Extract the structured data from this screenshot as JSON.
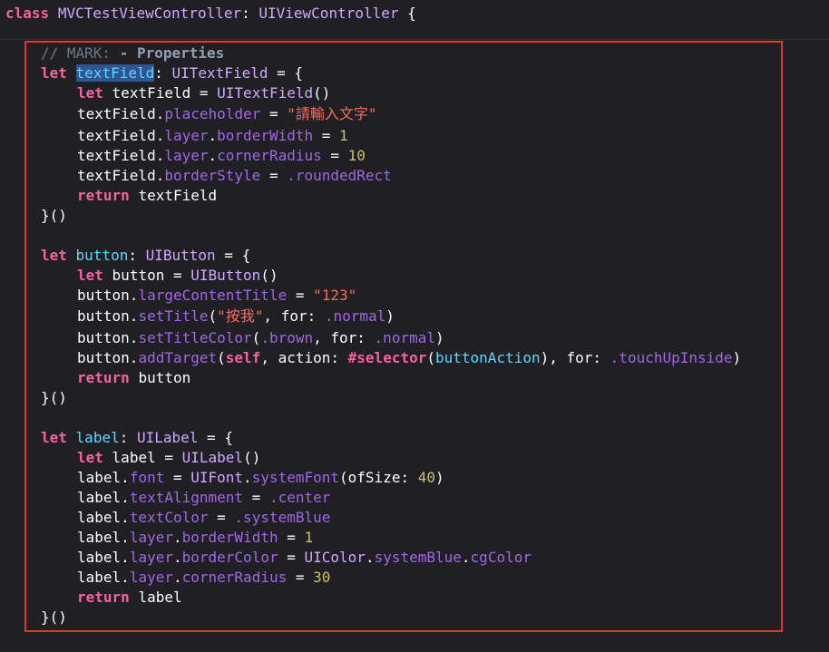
{
  "editor": {
    "class_keyword": "class",
    "class_name": "MVCTestViewController",
    "superclass": "UIViewController",
    "open_brace": "{",
    "mark_comment": "// MARK: ",
    "mark_title": "- Properties",
    "kw_let": "let",
    "kw_return": "return",
    "textfield_name": "textField",
    "textfield_type": "UITextField",
    "button_name": "button",
    "button_type": "UIButton",
    "label_name": "label",
    "label_type": "UILabel",
    "placeholder_prop": "placeholder",
    "placeholder_value": "\"請輸入文字\"",
    "layer_prop": "layer",
    "borderWidth_prop": "borderWidth",
    "borderWidth_tf": "1",
    "cornerRadius_prop": "cornerRadius",
    "cornerRadius_tf": "10",
    "borderStyle_prop": "borderStyle",
    "borderStyle_value": ".roundedRect",
    "largeContentTitle_prop": "largeContentTitle",
    "largeContentTitle_value": "\"123\"",
    "setTitle_fn": "setTitle",
    "setTitle_value": "\"按我\"",
    "for_label": "for:",
    "normal_value": ".normal",
    "setTitleColor_fn": "setTitleColor",
    "brown_value": ".brown",
    "addTarget_fn": "addTarget",
    "kw_self": "self",
    "action_label": "action:",
    "selector_kw": "#selector",
    "buttonAction": "buttonAction",
    "touchUpInside_value": ".touchUpInside",
    "font_prop": "font",
    "uifont_type": "UIFont",
    "systemFont_fn": "systemFont",
    "ofSize_label": "ofSize:",
    "font_size": "40",
    "textAlignment_prop": "textAlignment",
    "center_value": ".center",
    "textColor_prop": "textColor",
    "systemBlue_value": ".systemBlue",
    "borderWidth_label": "1",
    "borderColor_prop": "borderColor",
    "uicolor_type": "UIColor",
    "systemBlue_prop": "systemBlue",
    "cgColor_prop": "cgColor",
    "cornerRadius_label": "30",
    "closure_end": "}()"
  }
}
